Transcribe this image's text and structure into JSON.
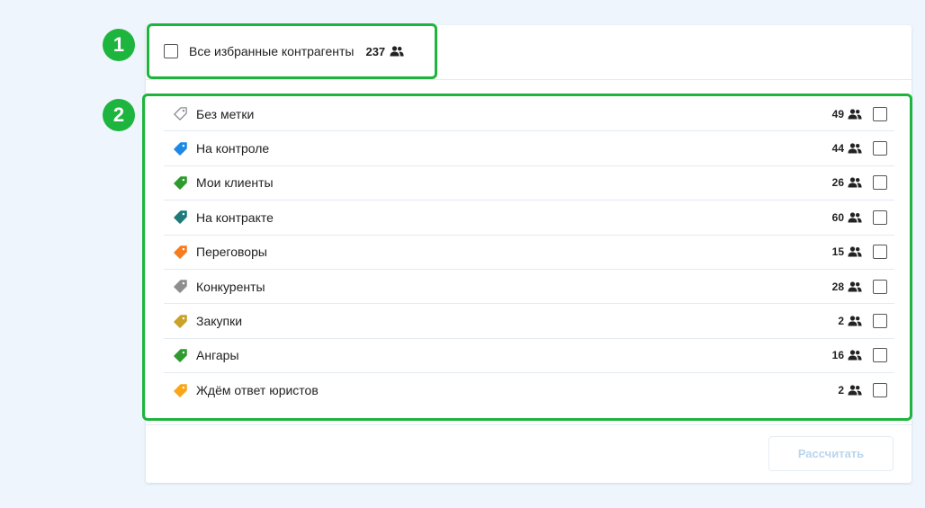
{
  "callouts": [
    "1",
    "2"
  ],
  "all_contractors": {
    "label": "Все избранные контрагенты",
    "count": "237",
    "icon": "people-icon"
  },
  "tags": [
    {
      "label": "Без метки",
      "count": "49",
      "color": "#ffffff",
      "outline": "#8a8f96"
    },
    {
      "label": "На контроле",
      "count": "44",
      "color": "#1e88e5"
    },
    {
      "label": "Мои клиенты",
      "count": "26",
      "color": "#2e9b2e"
    },
    {
      "label": "На контракте",
      "count": "60",
      "color": "#1d7a7a"
    },
    {
      "label": "Переговоры",
      "count": "15",
      "color": "#f57c1f"
    },
    {
      "label": "Конкуренты",
      "count": "28",
      "color": "#8e8e8e"
    },
    {
      "label": "Закупки",
      "count": "2",
      "color": "#c9a227"
    },
    {
      "label": "Ангары",
      "count": "16",
      "color": "#2e9b2e"
    },
    {
      "label": "Ждём ответ юристов",
      "count": "2",
      "color": "#f9a61a"
    }
  ],
  "calculate_button": {
    "label": "Рассчитать",
    "color": "#b9d5f0"
  },
  "highlight_color": "#1db53d"
}
